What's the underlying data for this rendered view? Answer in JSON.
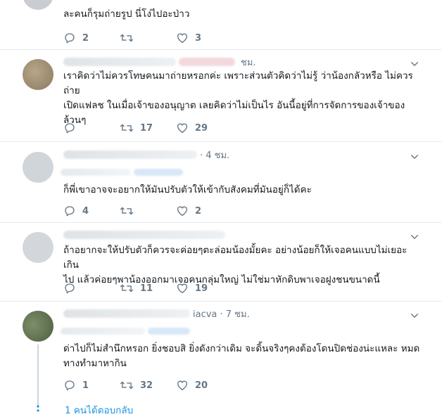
{
  "tweets": [
    {
      "header_suffix": "",
      "text": "ละคนก็รุมถ่ายรูป นี่โง่ไปอะป่าว",
      "replies": "2",
      "retweets": "",
      "likes": "3"
    },
    {
      "header_suffix": "ชม.",
      "text": "เราคิดว่าไม่ควรโทษคนมาถ่ายหรอกค่ะ เพราะส่วนตัวคิดว่าไม่รู้ ว่าน้องกลัวหรือ ไม่ควรถ่าย\nเปิดแฟลช ในเมื่อเจ้าของอนุญาต เลยคิดว่าไม่เป็นไร อันนี้อยู่ที่การจัดการของเจ้าของ\nล้วนๆ",
      "replies": "",
      "retweets": "17",
      "likes": "29"
    },
    {
      "header_suffix": "· 4 ชม.",
      "text": "ก็พี่เขาอาจจะอยากให้มันปรับตัวให้เข้ากับสังคมที่มันอยู่ก็ได้คะ",
      "replies": "4",
      "retweets": "",
      "likes": "2"
    },
    {
      "header_suffix": "",
      "text": "ถ้าอยากจะให้ปรับตัวก็ควรจะค่อยๆตะล่อมน้องมั้ยคะ อย่างน้อยก็ให้เจอคนแบบไม่เยอะเกิน\nไป แล้วค่อยๆพาน้องออกมาเจอคนกลุ่มใหญ่ ไม่ใช่มาหักดิบพาเจอฝูงชนขนาดนี้",
      "replies": "",
      "retweets": "11",
      "likes": "19"
    },
    {
      "header_suffix": "iacva · 7 ชม.",
      "text": "ด่าไปก็ไม่สำนึกหรอก ยิ่งชอบสิ ยิ่งดังกว่าเดิม จะดิ้นจริงๆคงต้องโดนปิดช่องน่ะแหละ หมด\nทางทำมาหากิน",
      "replies": "1",
      "retweets": "32",
      "likes": "20"
    }
  ],
  "show_replies": "1 คนได้ตอบกลับ",
  "colors": {
    "accent": "#1b95e0",
    "muted": "#657786",
    "divider": "#e6ecf0"
  }
}
